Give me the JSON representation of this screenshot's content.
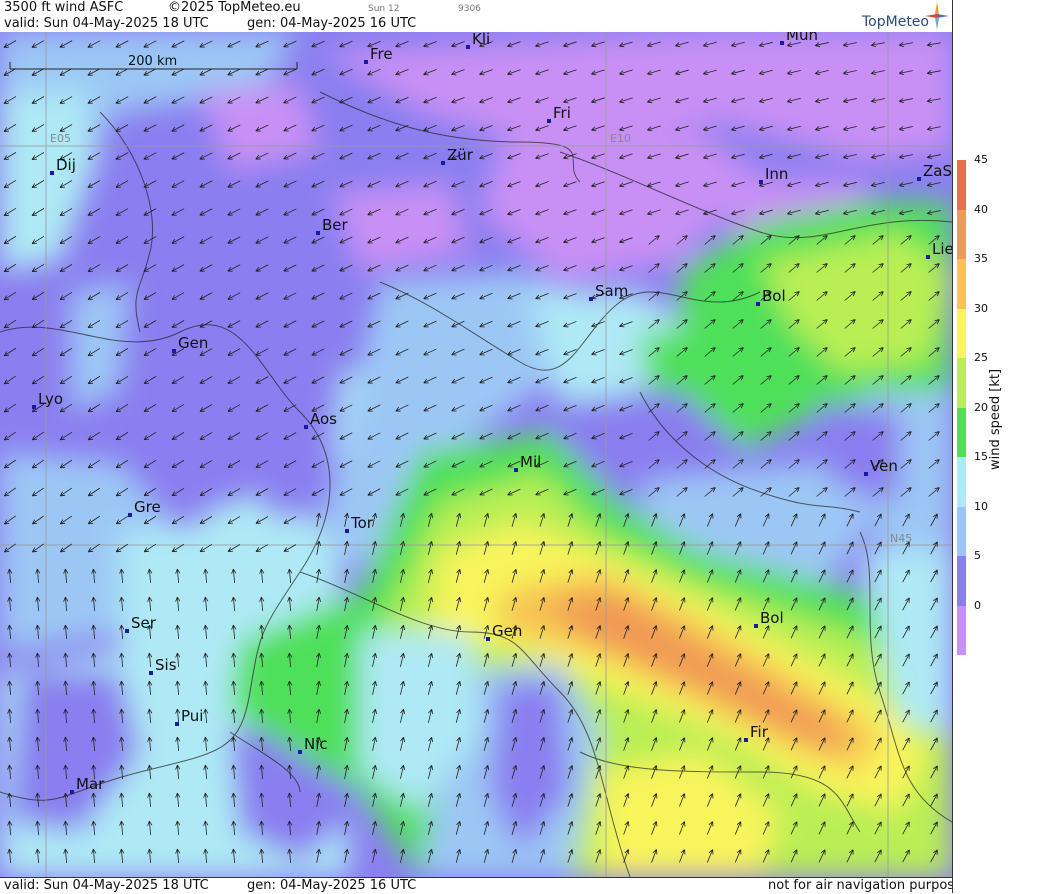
{
  "header": {
    "product": "3500 ft wind ASFC",
    "copyright": "©2025 TopMeteo.eu",
    "day_code": "Sun 12",
    "small_code": "9306",
    "valid": "valid:  Sun  04-May-2025  18 UTC",
    "gen": "gen: 04-May-2025 16 UTC",
    "logo": "TopMeteo"
  },
  "footer": {
    "valid": "valid:  Sun  04-May-2025  18 UTC",
    "gen": "gen: 04-May-2025 16 UTC",
    "disclaimer": "not for air navigation purposes"
  },
  "scale_bar": {
    "label": "200 km"
  },
  "grid_labels": [
    "E05",
    "E10",
    "N45"
  ],
  "colorbar": {
    "title": "wind speed [kt]",
    "ticks": [
      "45",
      "40",
      "35",
      "30",
      "25",
      "20",
      "15",
      "10",
      "5",
      "0"
    ],
    "colors": [
      "#c890f5",
      "#8a7ef0",
      "#9cc7f5",
      "#aee9f5",
      "#4fe05a",
      "#b9ef54",
      "#f8f45c",
      "#f7c452",
      "#f19a55",
      "#ec6e50"
    ]
  },
  "cities": [
    {
      "name": "Kli"
    },
    {
      "name": "Mün"
    },
    {
      "name": "Fre"
    },
    {
      "name": "Fri"
    },
    {
      "name": "Dij"
    },
    {
      "name": "Zür"
    },
    {
      "name": "Inn"
    },
    {
      "name": "ZaS"
    },
    {
      "name": "Ber"
    },
    {
      "name": "Lie"
    },
    {
      "name": "Sam"
    },
    {
      "name": "Bol"
    },
    {
      "name": "Gen"
    },
    {
      "name": "Lyo"
    },
    {
      "name": "Aos"
    },
    {
      "name": "Mil"
    },
    {
      "name": "Ven"
    },
    {
      "name": "Gre"
    },
    {
      "name": "Tor"
    },
    {
      "name": "Ser"
    },
    {
      "name": "Gen"
    },
    {
      "name": "Bol"
    },
    {
      "name": "Sis"
    },
    {
      "name": "Pui"
    },
    {
      "name": "Fir"
    },
    {
      "name": "Nic"
    },
    {
      "name": "Mar"
    }
  ]
}
